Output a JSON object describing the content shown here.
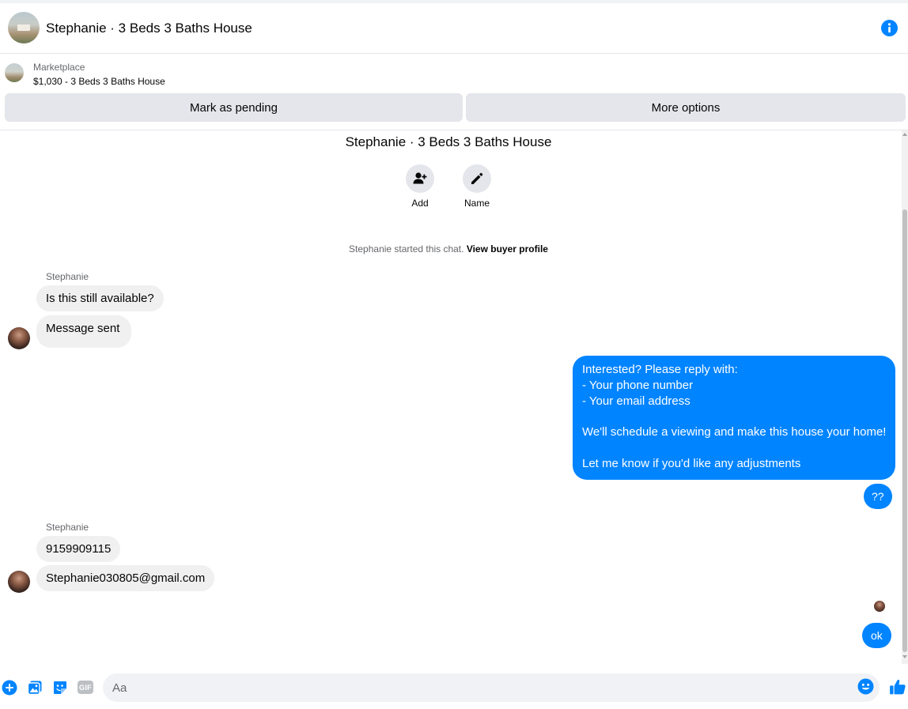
{
  "header": {
    "title": "Stephanie · 3 Beds 3 Baths House",
    "info_icon": "info-icon"
  },
  "marketplace": {
    "label": "Marketplace",
    "listing": "$1,030 - 3 Beds 3 Baths House",
    "buttons": {
      "pending": "Mark as pending",
      "more": "More options"
    }
  },
  "conversation": {
    "title": "Stephanie · 3 Beds 3 Baths House",
    "actions": [
      {
        "label": "Add",
        "icon": "add-person-icon"
      },
      {
        "label": "Name",
        "icon": "pencil-icon"
      }
    ],
    "system_message": {
      "text": "Stephanie started this chat.",
      "link": "View buyer profile"
    },
    "groups": [
      {
        "sender": "Stephanie",
        "messages": [
          "Is this still available?",
          "Message sent"
        ]
      },
      {
        "sender": "Stephanie",
        "messages": [
          "9159909115",
          "Stephanie030805@gmail.com"
        ]
      }
    ],
    "outgoing": {
      "long_message": [
        "Interested? Please reply with:",
        "- Your phone number",
        "- Your email address",
        "",
        "We'll schedule a viewing and make this house your home!",
        "",
        "Let me know if you'd like any adjustments"
      ],
      "short1": "??",
      "short2": "ok"
    }
  },
  "composer": {
    "placeholder": "Aa",
    "icons": [
      "plus-icon",
      "photo-icon",
      "sticker-icon",
      "gif-icon",
      "emoji-icon",
      "thumbs-up-icon"
    ],
    "gif_label": "GIF"
  },
  "colors": {
    "accent": "#0084ff",
    "incoming_bubble": "#f0f0f0",
    "button_bg": "#e4e6eb"
  }
}
